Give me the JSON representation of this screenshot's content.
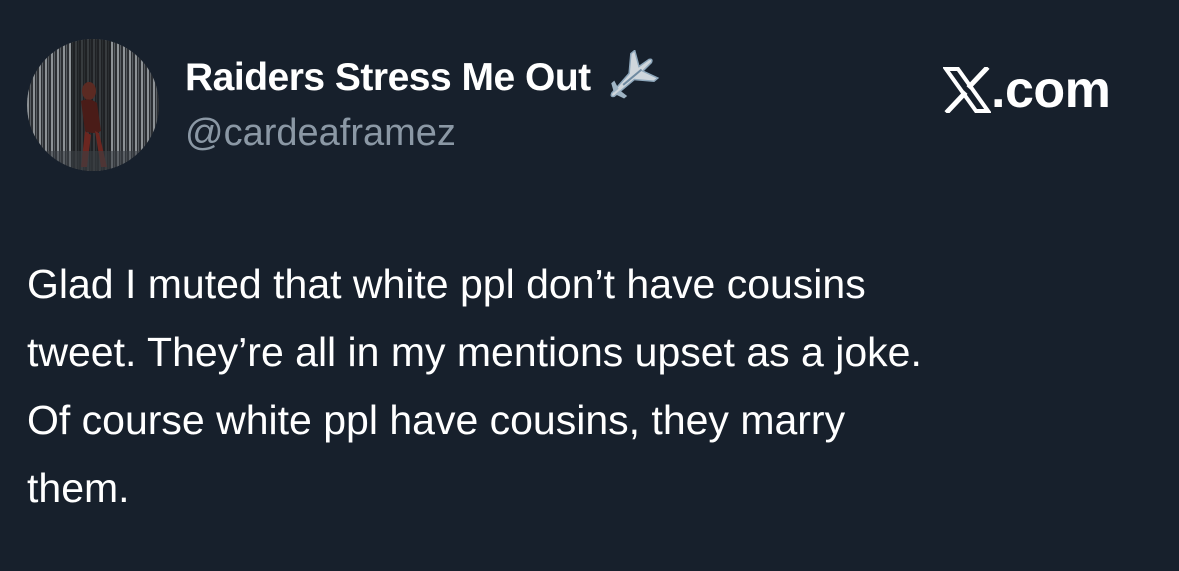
{
  "author": {
    "display_name": "Raiders Stress Me Out",
    "handle": "@cardeaframez",
    "badge_icon": "airplane-icon",
    "avatar_icon": "avatar-photo"
  },
  "brand": {
    "icon": "x-logo-icon",
    "text": ".com"
  },
  "tweet": {
    "lines": [
      "Glad I muted that white ppl don’t have cousins",
      "tweet. They’re all in my mentions upset as a joke.",
      "Of course white ppl have cousins, they marry",
      "them."
    ]
  },
  "colors": {
    "background": "#17202c",
    "text_primary": "#ffffff",
    "text_secondary": "#8b98a5"
  }
}
